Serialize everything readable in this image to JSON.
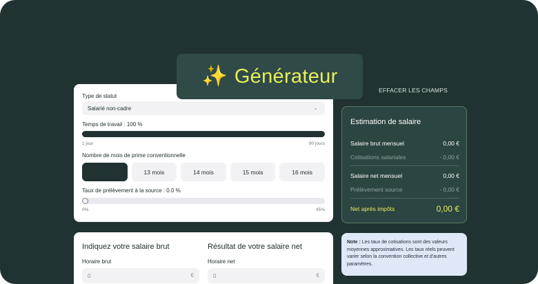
{
  "generator": {
    "icon": "sparkles-icon",
    "title": "Générateur",
    "accent_color": "#e7ef5a"
  },
  "clear_link": "EFFACER LES CHAMPS",
  "form": {
    "status_label": "Type de statut",
    "status_value": "Salarié non-cadre",
    "work_time_label": "Temps de travail : 100 %",
    "work_time_value_pct": 100,
    "work_time_min": "1 jour",
    "work_time_max": "90 jours",
    "bonus_label": "Nombre de mois de prime conventionnelle",
    "bonus_options": [
      "",
      "13 mois",
      "14 mois",
      "15 mois",
      "16 mois"
    ],
    "bonus_selected_index": 0,
    "withholding_label": "Taux de prélèvement à la source : 0.0 %",
    "withholding_value_pct": 0,
    "withholding_min": "0%",
    "withholding_max": "45%"
  },
  "estimation": {
    "title": "Estimation de salaire",
    "rows": [
      {
        "label": "Salaire brut mensuel",
        "value": "0,00 €"
      },
      {
        "label": "Cotisations salariales",
        "value": "- 0,00 €"
      },
      {
        "label": "Salaire net mensuel",
        "value": "0,00 €"
      },
      {
        "label": "Prélèvement source",
        "value": "- 0,00 €"
      },
      {
        "label": "Net après impôts",
        "value": "0,00 €"
      }
    ]
  },
  "note": {
    "bold": "Note :",
    "text": " Les taux de cotisations sont des valeurs moyennes approximatives. Les taux réels peuvent varier selon la convention collective et d'autres paramètres."
  },
  "gross": {
    "title": "Indiquez votre salaire brut",
    "hourly_label": "Horaire brut",
    "hourly_placeholder": "0",
    "currency": "€"
  },
  "net": {
    "title": "Résultat de votre salaire net",
    "hourly_label": "Horaire net",
    "hourly_placeholder": "0",
    "currency": "€"
  }
}
